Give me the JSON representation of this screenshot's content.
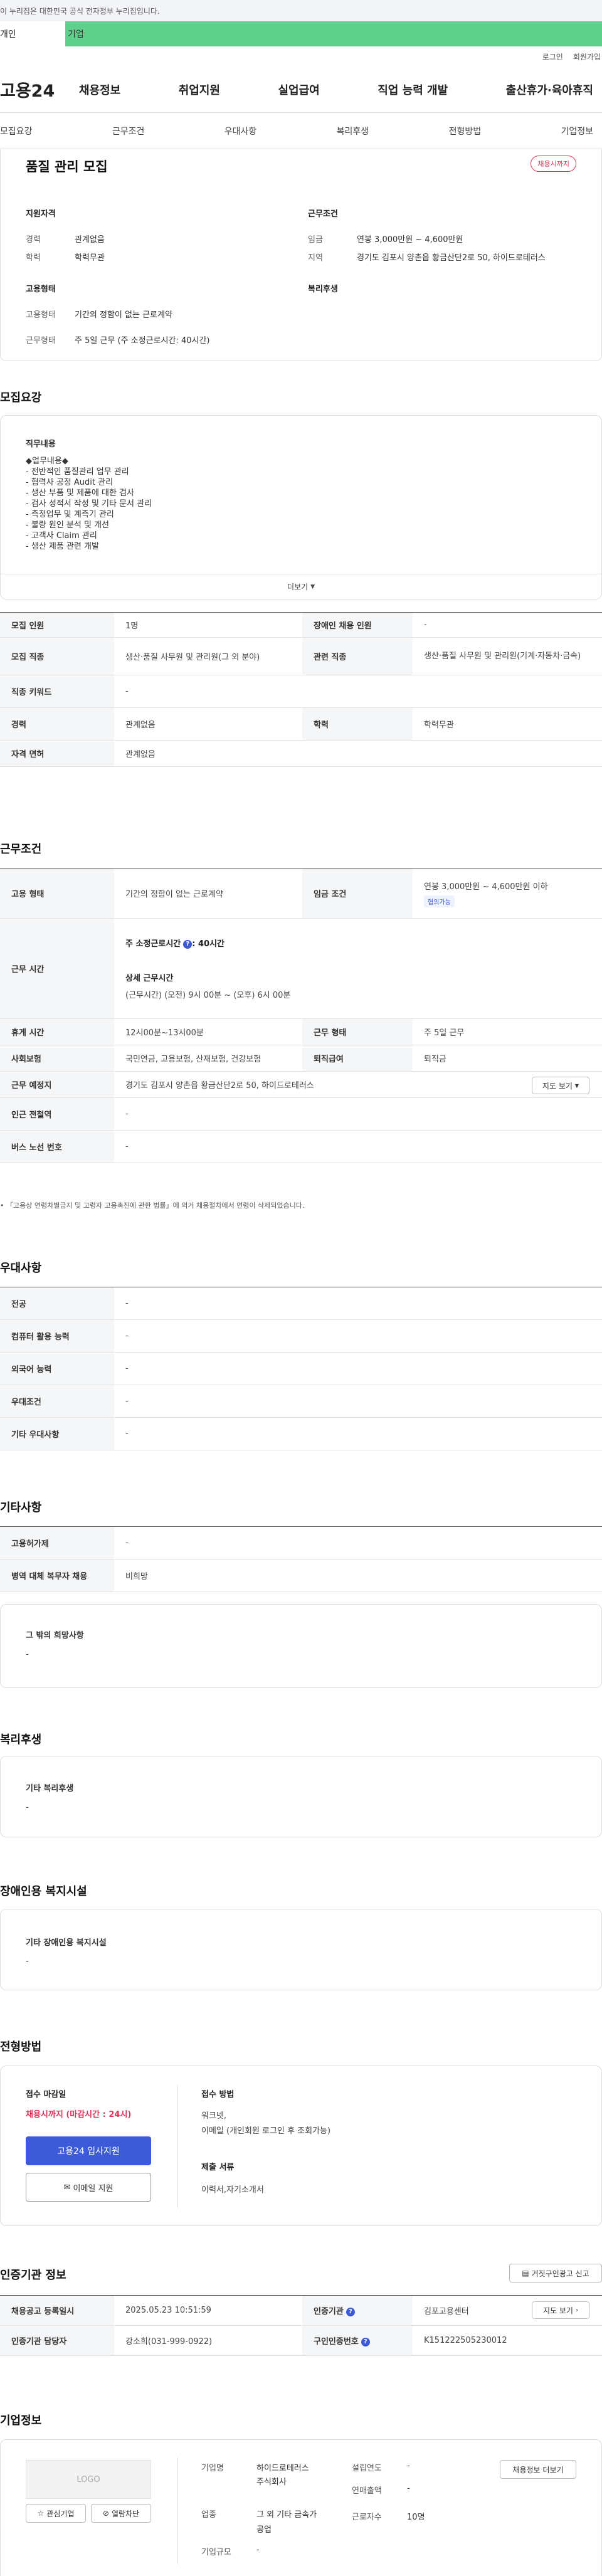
{
  "top_banner": "이 누리집은 대한민국 공식 전자정부 누리집입니다.",
  "gov_tabs": {
    "personal": "개인",
    "company": "기업"
  },
  "util": {
    "login": "로그인",
    "join": "회원가입"
  },
  "logo": "고용24",
  "gnb": [
    "채용정보",
    "취업지원",
    "실업급여",
    "직업 능력 개발",
    "출산휴가·육아휴직"
  ],
  "anchors": [
    "모집요강",
    "근무조건",
    "우대사항",
    "복리후생",
    "전형방법",
    "기업정보"
  ],
  "summary": {
    "title": "품질 관리 모집",
    "badge": "채용시까지",
    "qual_label": "지원자격",
    "career_k": "경력",
    "career_v": "관계없음",
    "edu_k": "학력",
    "edu_v": "학력무관",
    "cond_label": "근무조건",
    "wage_k": "임금",
    "wage_v": "연봉 3,000만원 ~ 4,600만원",
    "region_k": "지역",
    "region_v": "경기도 김포시 양촌읍 황금산단2로 50, 하이드로테러스",
    "emp_label": "고용형태",
    "emptype_k": "고용형태",
    "emptype_v": "기간의 정함이 없는 근로계약",
    "worktype_k": "근무형태",
    "worktype_v": "주 5일 근무 (주 소정근로시간: 40시간)",
    "welfare_label": "복리후생"
  },
  "recruit": {
    "title": "모집요강",
    "duty_label": "직무내용",
    "duty_lines": [
      "◆업무내용◆",
      "- 전반적인 품질관리 업무 관리",
      "- 협력사 공정 Audit 관리",
      "- 생산 부품 및 제품에 대한 검사",
      "- 검사 성적서 작성 및 기타 문서 관리",
      "- 측정업무 및 계측기 관리",
      "- 불량 원인 분석 및 개선",
      "- 고객사 Claim 관리",
      "- 생산 제품 관련 개발"
    ],
    "more": "더보기",
    "rows": [
      {
        "k1": "모집 인원",
        "v1": "1명",
        "k2": "장애인 채용 인원",
        "v2": "-"
      },
      {
        "k1": "모집 직종",
        "v1": "생산·품질 사무원 및 관리원(그 외 분야)",
        "k2": "관련 직종",
        "v2": "생산·품질 사무원 및 관리원(기계·자동차·금속)"
      },
      {
        "k1": "직종 키워드",
        "v1": "-"
      },
      {
        "k1": "경력",
        "v1": "관계없음",
        "k2": "학력",
        "v2": "학력무관"
      },
      {
        "k1": "자격 면허",
        "v1": "관계없음"
      }
    ]
  },
  "workcond": {
    "title": "근무조건",
    "emp_k": "고용 형태",
    "emp_v": "기간의 정함이 없는 근로계약",
    "wage_k": "임금 조건",
    "wage_v": "연봉 3,000만원 ~ 4,600만원 이하",
    "wage_pill": "협의가능",
    "hours_k": "근무 시간",
    "hours_weekly": "주 소정근로시간",
    "hours_weekly_val": ": 40시간",
    "hours_detail_label": "상세 근무시간",
    "hours_detail": "(근무시간) (오전) 9시 00분 ~ (오후) 6시 00분",
    "break_k": "휴게 시간",
    "break_v": "12시00분~13시00분",
    "form_k": "근무 형태",
    "form_v": "주 5일 근무",
    "ins_k": "사회보험",
    "ins_v": "국민연금, 고용보험, 산재보험, 건강보험",
    "ret_k": "퇴직급여",
    "ret_v": "퇴직금",
    "place_k": "근무 예정지",
    "place_v": "경기도 김포시 양촌읍 황금산단2로 50, 하이드로테러스",
    "map_btn": "지도 보기",
    "subway_k": "인근 전철역",
    "subway_v": "-",
    "bus_k": "버스 노선 번호",
    "bus_v": "-",
    "note": "「고용상 연령차별금지 및 고령자 고용촉진에 관한 법률」에 의거 채용절차에서 연령이 삭제되었습니다."
  },
  "pref": {
    "title": "우대사항",
    "rows": [
      {
        "k": "전공",
        "v": "-"
      },
      {
        "k": "컴퓨터 활용 능력",
        "v": "-"
      },
      {
        "k": "외국어 능력",
        "v": "-"
      },
      {
        "k": "우대조건",
        "v": "-"
      },
      {
        "k": "기타 우대사항",
        "v": "-"
      }
    ]
  },
  "etc": {
    "title": "기타사항",
    "rows": [
      {
        "k": "고용허가제",
        "v": "-"
      },
      {
        "k": "병역 대체 복무자 채용",
        "v": "비희망"
      }
    ],
    "box_label": "그 밖의 희망사항",
    "box_value": "-"
  },
  "welfare": {
    "title": "복리후생",
    "box_label": "기타 복리후생",
    "box_value": "-"
  },
  "disabled": {
    "title": "장애인용 복지시설",
    "box_label": "기타 장애인용 복지시설",
    "box_value": "-"
  },
  "selection": {
    "title": "전형방법",
    "deadline_label": "접수 마감일",
    "deadline_value": "채용시까지 (마감시간 : 24시)",
    "apply_btn": "고용24 입사지원",
    "email_btn": "이메일 지원",
    "method_label": "접수 방법",
    "method_value1": "워크넷,",
    "method_value2": "이메일 (개인회원 로그인 후 조회가능)",
    "docs_label": "제출 서류",
    "docs_value": "이력서,자기소개서"
  },
  "cert": {
    "title": "인증기관 정보",
    "report_btn": "거짓구인광고 신고",
    "reg_k": "채용공고 등록일시",
    "reg_v": "2025.05.23 10:51:59",
    "org_k": "인증기관",
    "org_v": "김포고용센터",
    "map_btn": "지도 보기",
    "mgr_k": "인증기관 담당자",
    "mgr_v": "강소희(031-999-0922)",
    "id_k": "구인인증번호",
    "id_v": "K151222505230012"
  },
  "company": {
    "title": "기업정보",
    "logo": "LOGO",
    "fav_btn": "관심기업",
    "block_btn": "열람차단",
    "name_k": "기업명",
    "name_v1": "하이드로테러스",
    "name_v2": "주식회사",
    "found_k": "설립연도",
    "found_v": "-",
    "sales_k": "연매출액",
    "sales_v": "-",
    "ind_k": "업종",
    "ind_v1": "그 외 기타 금속가",
    "ind_v2": "공업",
    "emp_k": "근로자수",
    "emp_v": "10명",
    "size_k": "기업규모",
    "size_v": "-",
    "jobs_btn": "채용정보 더보기"
  },
  "colors": {
    "brand_green": "#5fd08b",
    "accent_red": "#e0335a",
    "accent_blue": "#3d5bd9"
  }
}
